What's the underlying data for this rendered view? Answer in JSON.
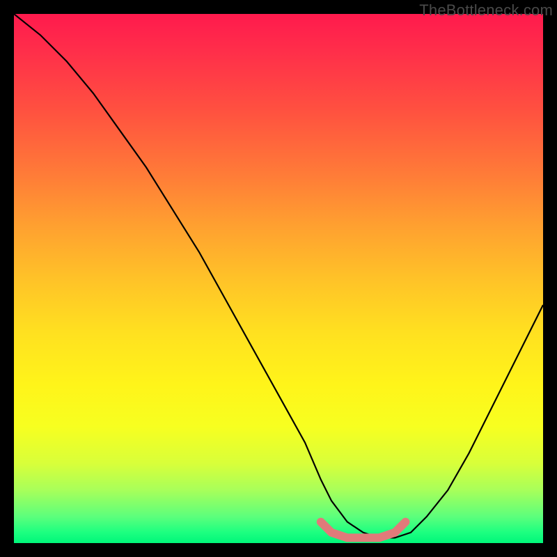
{
  "watermark": "TheBottleneck.com",
  "chart_data": {
    "type": "line",
    "title": "",
    "xlabel": "",
    "ylabel": "",
    "xlim": [
      0,
      100
    ],
    "ylim": [
      0,
      100
    ],
    "grid": false,
    "legend": false,
    "series": [
      {
        "name": "black-curve",
        "color": "#000000",
        "x": [
          0,
          5,
          10,
          15,
          20,
          25,
          30,
          35,
          40,
          45,
          50,
          55,
          58,
          60,
          63,
          66,
          69,
          72,
          75,
          78,
          82,
          86,
          90,
          95,
          100
        ],
        "y": [
          100,
          96,
          91,
          85,
          78,
          71,
          63,
          55,
          46,
          37,
          28,
          19,
          12,
          8,
          4,
          2,
          1,
          1,
          2,
          5,
          10,
          17,
          25,
          35,
          45
        ]
      },
      {
        "name": "pink-highlight",
        "color": "#e17a7a",
        "x": [
          58,
          60,
          63,
          66,
          69,
          72,
          74
        ],
        "y": [
          4,
          2,
          1,
          1,
          1,
          2,
          4
        ]
      }
    ],
    "background_gradient": {
      "direction": "vertical",
      "stops": [
        {
          "pos": 0,
          "color": "#ff1a4d"
        },
        {
          "pos": 50,
          "color": "#ffc228"
        },
        {
          "pos": 78,
          "color": "#f7ff20"
        },
        {
          "pos": 100,
          "color": "#00f67a"
        }
      ]
    }
  }
}
